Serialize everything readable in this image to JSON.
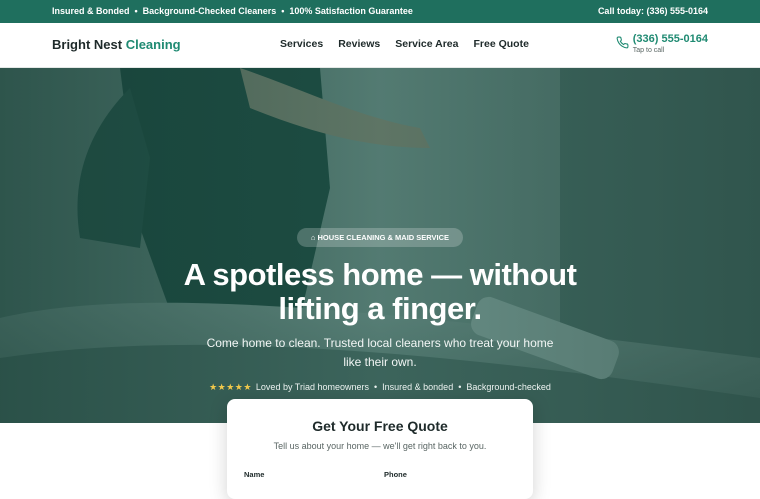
{
  "topbar": {
    "trust_1": "Insured & Bonded",
    "trust_2": "Background-Checked Cleaners",
    "trust_3": "100% Satisfaction Guarantee",
    "separator": "•",
    "call": "Call today: (336) 555-0164"
  },
  "nav": {
    "brand_main": "Bright Nest",
    "brand_accent": "Cleaning",
    "links": [
      "Services",
      "Reviews",
      "Service Area",
      "Free Quote"
    ],
    "phone": "(336) 555-0164",
    "phone_hint": "Tap to call"
  },
  "hero": {
    "badge": "⌂ HOUSE CLEANING & MAID SERVICE",
    "headline": "A spotless home — without lifting a finger.",
    "subtitle": "Come home to clean. Trusted local cleaners who treat your home like their own.",
    "stars": "★★★★★",
    "proof_1": "Loved by Triad homeowners",
    "proof_2": "Insured & bonded",
    "proof_3": "Background-checked",
    "separator": "•"
  },
  "quote": {
    "title": "Get Your Free Quote",
    "subtitle": "Tell us about your home — we'll get right back to you.",
    "name_label": "Name",
    "phone_label": "Phone"
  },
  "colors": {
    "brand": "#1f6f5e",
    "accent": "#1f8a72",
    "star": "#f2c94c"
  }
}
